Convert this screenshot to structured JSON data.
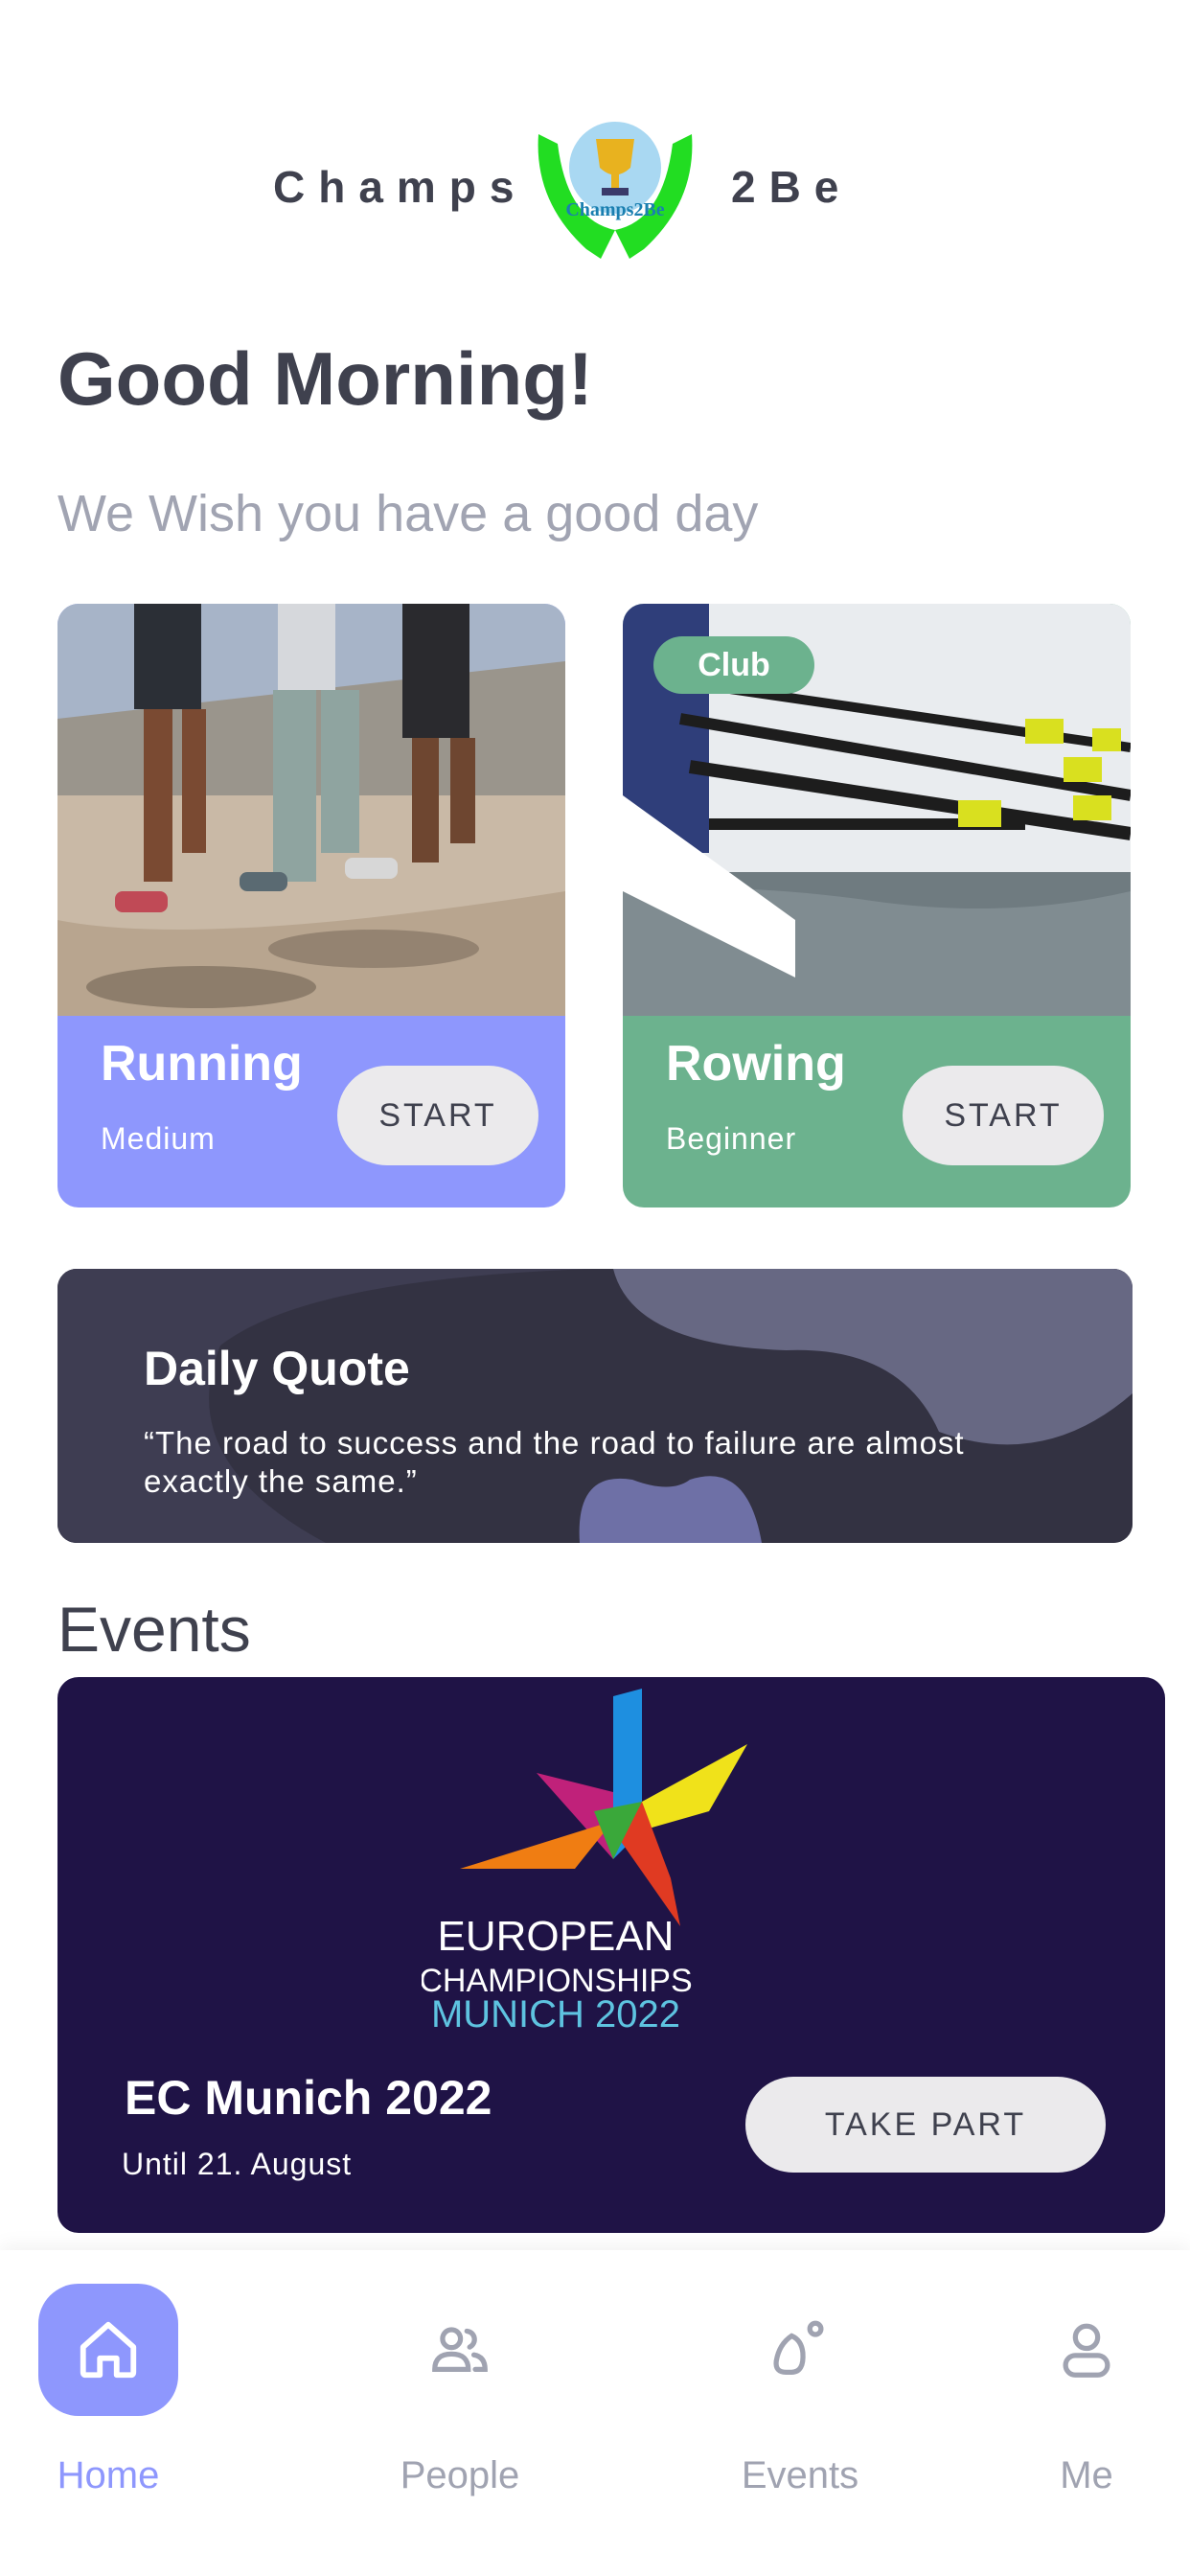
{
  "header": {
    "brand_left": "Champs",
    "brand_right": "2Be",
    "logo_text": "Champs2Be"
  },
  "greeting": {
    "title": "Good Morning!",
    "subtitle": "We Wish you have a good day"
  },
  "activities": [
    {
      "title": "Running",
      "level": "Medium",
      "button": "START",
      "color": "#8e97fd"
    },
    {
      "title": "Rowing",
      "level": "Beginner",
      "button": "START",
      "badge": "Club",
      "color": "#6cb28e"
    }
  ],
  "quote": {
    "title": "Daily Quote",
    "text": "“The road to success and the road to failure are almost exactly the same.”"
  },
  "events": {
    "heading": "Events",
    "card": {
      "logo_line1": "EUROPEAN",
      "logo_line2": "CHAMPIONSHIPS",
      "logo_line3": "MUNICH 2022",
      "name": "EC Munich 2022",
      "date": "Until 21. August",
      "button": "TAKE PART"
    }
  },
  "tabbar": {
    "items": [
      {
        "label": "Home",
        "icon": "home-icon",
        "active": true
      },
      {
        "label": "People",
        "icon": "people-icon",
        "active": false
      },
      {
        "label": "Events",
        "icon": "events-icon",
        "active": false
      },
      {
        "label": "Me",
        "icon": "user-icon",
        "active": false
      }
    ]
  },
  "colors": {
    "accent": "#8e97fd",
    "green": "#6cb28e",
    "dark": "#3f414e",
    "event_bg": "#1f1346",
    "quote_bg": "#333242"
  }
}
